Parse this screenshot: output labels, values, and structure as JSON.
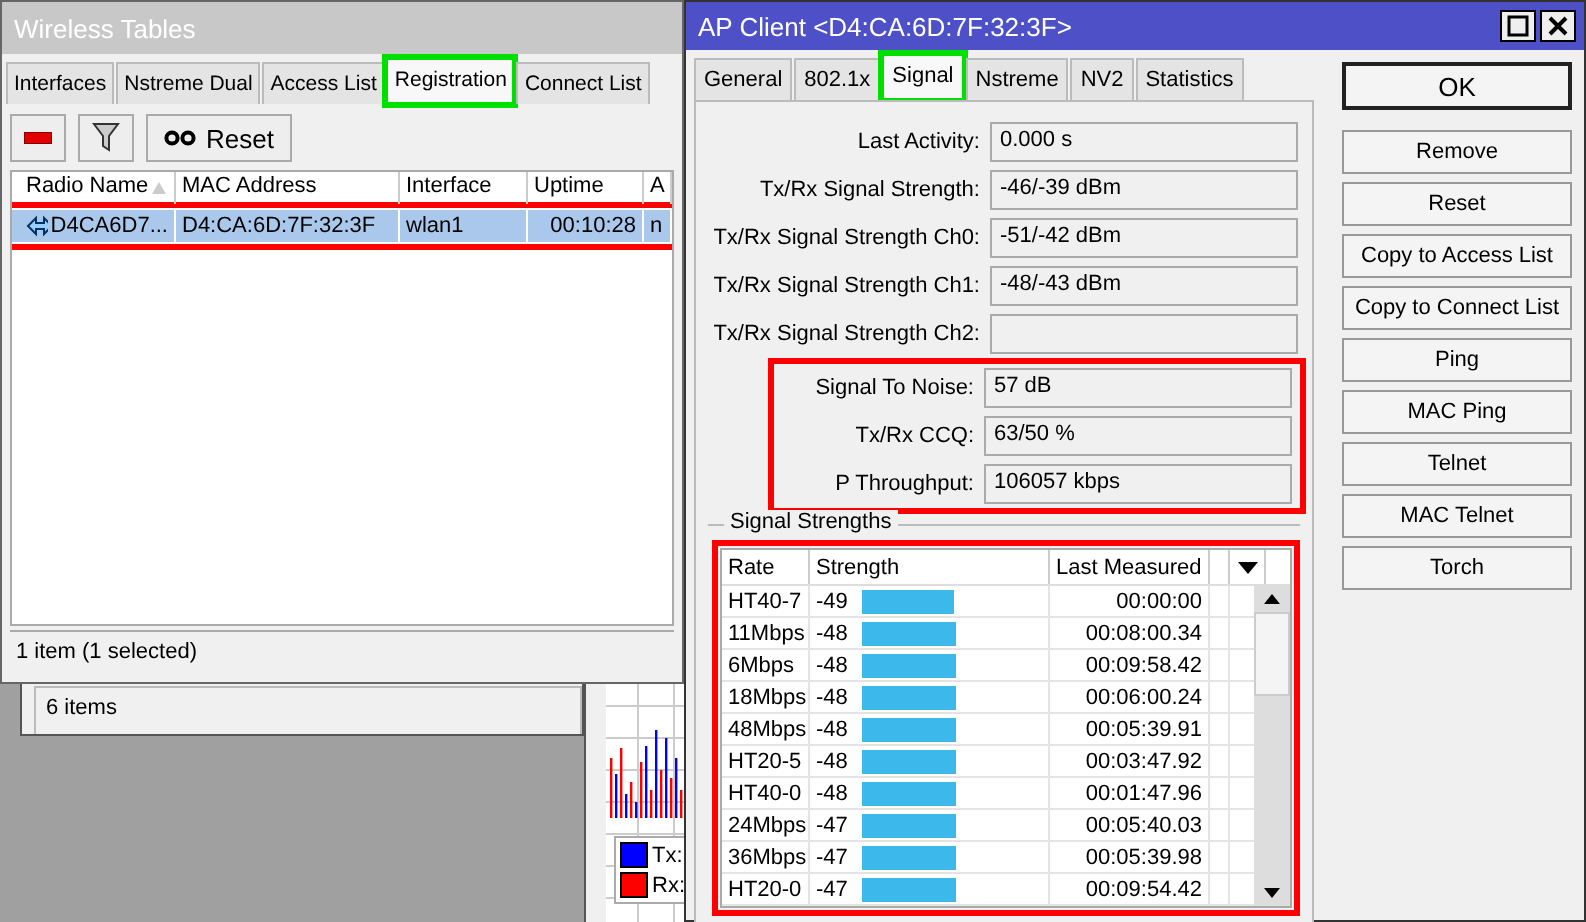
{
  "wireless_tables": {
    "title": "Wireless Tables",
    "tabs": [
      {
        "label": "Interfaces",
        "selected": false,
        "highlighted": false
      },
      {
        "label": "Nstreme Dual",
        "selected": false,
        "highlighted": false
      },
      {
        "label": "Access List",
        "selected": false,
        "highlighted": false
      },
      {
        "label": "Registration",
        "selected": true,
        "highlighted": true
      },
      {
        "label": "Connect List",
        "selected": false,
        "highlighted": false
      }
    ],
    "reset_label": "Reset",
    "columns": [
      "Radio Name",
      "MAC Address",
      "Interface",
      "Uptime",
      "A"
    ],
    "rows": [
      {
        "cells": [
          "D4CA6D7...",
          "D4:CA:6D:7F:32:3F",
          "wlan1",
          "00:10:28",
          "n"
        ],
        "selected": true,
        "highlighted": true
      }
    ],
    "status": "1 item (1 selected)"
  },
  "background_window": {
    "status": "6 items"
  },
  "traffic_window": {
    "legend": [
      {
        "label": "Tx:",
        "color": "#0000ff"
      },
      {
        "label": "Rx:",
        "color": "#ff0000"
      }
    ]
  },
  "ap_client": {
    "title": "AP Client <D4:CA:6D:7F:32:3F>",
    "tabs": [
      {
        "label": "General",
        "selected": false,
        "highlighted": false
      },
      {
        "label": "802.1x",
        "selected": false,
        "highlighted": false
      },
      {
        "label": "Signal",
        "selected": true,
        "highlighted": true
      },
      {
        "label": "Nstreme",
        "selected": false,
        "highlighted": false
      },
      {
        "label": "NV2",
        "selected": false,
        "highlighted": false
      },
      {
        "label": "Statistics",
        "selected": false,
        "highlighted": false
      }
    ],
    "fields": [
      {
        "label": "Last Activity:",
        "value": "0.000 s"
      },
      {
        "label": "Tx/Rx Signal Strength:",
        "value": "-46/-39 dBm"
      },
      {
        "label": "Tx/Rx Signal Strength Ch0:",
        "value": "-51/-42 dBm"
      },
      {
        "label": "Tx/Rx Signal Strength Ch1:",
        "value": "-48/-43 dBm"
      },
      {
        "label": "Tx/Rx Signal Strength Ch2:"
      }
    ],
    "highlighted_fields": [
      {
        "label": "Signal To Noise:",
        "value": "57 dB"
      },
      {
        "label": "Tx/Rx CCQ:",
        "value": "63/50 %"
      },
      {
        "label": "P Throughput:",
        "value": "106057 kbps"
      }
    ],
    "group_title": "Signal Strengths",
    "table": {
      "highlighted": true,
      "columns": [
        "Rate",
        "Strength",
        "Last Measured"
      ],
      "rows": [
        {
          "rate": "HT40-7",
          "strength": "-49",
          "level": 0.49,
          "last": "00:00:00"
        },
        {
          "rate": "11Mbps",
          "strength": "-48",
          "level": 0.5,
          "last": "00:08:00.34"
        },
        {
          "rate": "6Mbps",
          "strength": "-48",
          "level": 0.5,
          "last": "00:09:58.42"
        },
        {
          "rate": "18Mbps",
          "strength": "-48",
          "level": 0.5,
          "last": "00:06:00.24"
        },
        {
          "rate": "48Mbps",
          "strength": "-48",
          "level": 0.5,
          "last": "00:05:39.91"
        },
        {
          "rate": "HT20-5",
          "strength": "-48",
          "level": 0.5,
          "last": "00:03:47.92"
        },
        {
          "rate": "HT40-0",
          "strength": "-48",
          "level": 0.5,
          "last": "00:01:47.96"
        },
        {
          "rate": "24Mbps",
          "strength": "-47",
          "level": 0.51,
          "last": "00:05:40.03"
        },
        {
          "rate": "36Mbps",
          "strength": "-47",
          "level": 0.51,
          "last": "00:05:39.98"
        },
        {
          "rate": "HT20-0",
          "strength": "-47",
          "level": 0.51,
          "last": "00:09:54.42"
        }
      ]
    },
    "buttons": [
      {
        "label": "OK",
        "default": true
      },
      {
        "label": "Remove",
        "default": false
      },
      {
        "label": "Reset",
        "default": false
      },
      {
        "label": "Copy to Access List",
        "default": false
      },
      {
        "label": "Copy to Connect List",
        "default": false
      },
      {
        "label": "Ping",
        "default": false
      },
      {
        "label": "MAC Ping",
        "default": false
      },
      {
        "label": "Telnet",
        "default": false
      },
      {
        "label": "MAC Telnet",
        "default": false
      },
      {
        "label": "Torch",
        "default": false
      }
    ]
  }
}
